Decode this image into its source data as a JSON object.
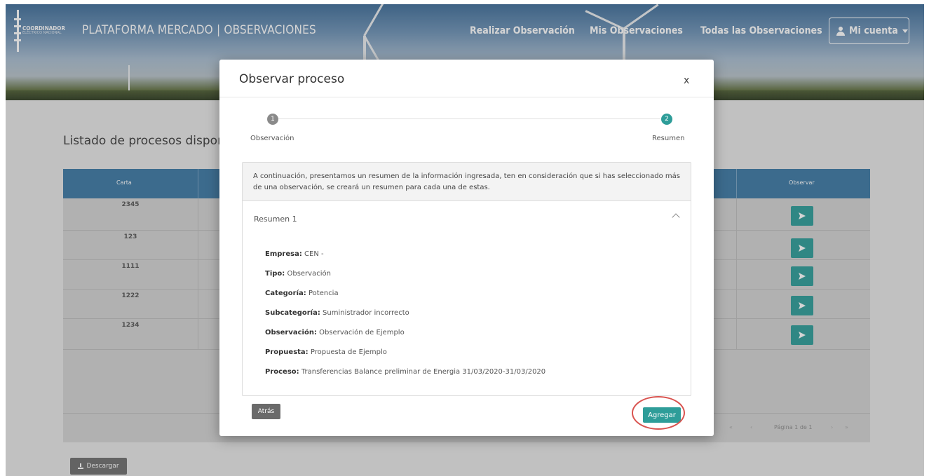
{
  "header": {
    "brand_small": "COORDINADOR",
    "brand_sub": "ELÉCTRICO NACIONAL",
    "app_title": "PLATAFORMA MERCADO | OBSERVACIONES",
    "nav": [
      "Realizar Observación",
      "Mis Observaciones",
      "Todas las Observaciones"
    ],
    "account_label": "Mi cuenta"
  },
  "background": {
    "list_title": "Listado de procesos dispon",
    "table": {
      "col_carta": "Carta",
      "col_observar": "Observar",
      "rows": [
        {
          "carta": "2345"
        },
        {
          "carta": "123"
        },
        {
          "carta": "1111"
        },
        {
          "carta": "1222"
        },
        {
          "carta": "1234"
        }
      ]
    },
    "pager": "Página 1 de 1",
    "download_label": "Descargar"
  },
  "modal": {
    "title": "Observar proceso",
    "close": "x",
    "steps": [
      {
        "number": "1",
        "label": "Observación"
      },
      {
        "number": "2",
        "label": "Resumen"
      }
    ],
    "intro": "A continuación, presentamos un resumen de la información ingresada, ten en consideración que si has seleccionado más de una observación, se creará un resumen para cada una de estas.",
    "summary_title": "Resumen 1",
    "fields": [
      {
        "label": "Empresa:",
        "value": "CEN -"
      },
      {
        "label": "Tipo:",
        "value": "Observación"
      },
      {
        "label": "Categoría:",
        "value": "Potencia"
      },
      {
        "label": "Subcategoría:",
        "value": "Suministrador incorrecto"
      },
      {
        "label": "Observación:",
        "value": "Observación de Ejemplo"
      },
      {
        "label": "Propuesta:",
        "value": "Propuesta de Ejemplo"
      },
      {
        "label": "Proceso:",
        "value": "Transferencias Balance preliminar de Energia 31/03/2020-31/03/2020"
      }
    ],
    "back_label": "Atrás",
    "add_label": "Agregar"
  },
  "colors": {
    "accent": "#2e9d99",
    "table_header": "#3d79a5",
    "highlight": "#d9534f",
    "step_done": "#8a8a8a"
  },
  "icons": {
    "account": "user-icon",
    "send": "paper-plane-icon",
    "download": "download-icon",
    "accordion": "chevron-up-icon"
  }
}
